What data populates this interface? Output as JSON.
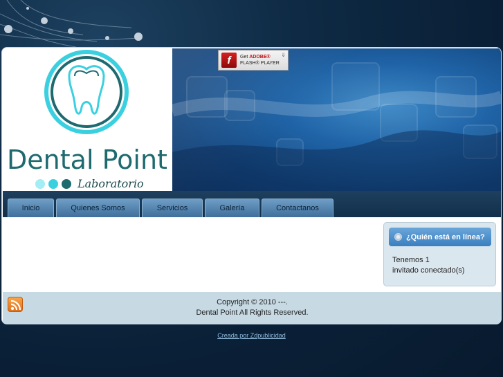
{
  "brand": {
    "name": "Dental Point",
    "subtitle": "Laboratorio",
    "colors": {
      "teal": "#2aa7a8",
      "cyan": "#3ad0e0",
      "dark_teal": "#1e6a6f"
    }
  },
  "flash_badge": {
    "line1_prefix": "Get",
    "line1_brand": "ADOBE®",
    "line2": "FLASH® PLAYER",
    "icon": "flash-player-icon"
  },
  "nav": {
    "tabs": [
      {
        "label": "Inicio"
      },
      {
        "label": "Quienes Somos"
      },
      {
        "label": "Servicios"
      },
      {
        "label": "Galería"
      },
      {
        "label": "Contactanos"
      }
    ]
  },
  "online_module": {
    "title": "¿Quién está en línea?",
    "line1": "Tenemos 1",
    "line2": "invitado conectado(s)"
  },
  "footer": {
    "copyright": "Copyright © 2010 ---.",
    "rights": "Dental Point All Rights Reserved.",
    "rss_icon": "rss-icon"
  },
  "credit": {
    "text": "Creada por Zdpublicidad"
  }
}
